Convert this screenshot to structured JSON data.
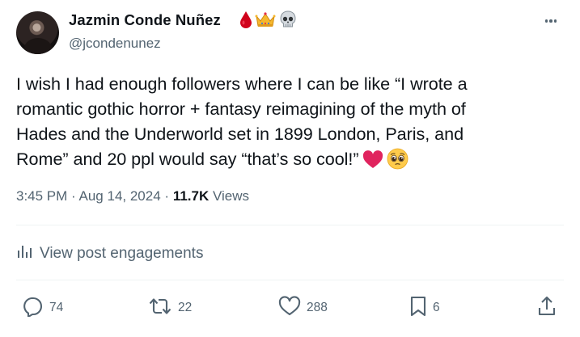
{
  "author": {
    "display_name": "Jazmin Conde Nuñez",
    "handle": "@jcondenunez",
    "name_emojis": [
      "drop-of-blood-icon",
      "crown-icon",
      "skull-icon"
    ]
  },
  "tweet": {
    "lines": [
      "I wish I had enough followers where I can be like “I wrote a",
      "romantic gothic horror + fantasy reimagining of the myth of",
      "Hades and the Underworld set in 1899 London, Paris, and",
      "Rome” and  20 ppl would say “that’s so cool!”"
    ],
    "trailing_emojis": [
      "red-heart-icon",
      "pleading-face-icon"
    ]
  },
  "meta": {
    "time": "3:45 PM",
    "separator": "·",
    "date": "Aug 14, 2024",
    "views_count": "11.7K",
    "views_label": "Views"
  },
  "engagements": {
    "label": "View post engagements"
  },
  "actions": {
    "replies": "74",
    "reposts": "22",
    "likes": "288",
    "bookmarks": "6"
  },
  "colors": {
    "text_primary": "#0f1419",
    "text_secondary": "#536471",
    "divider": "#eff3f4",
    "heart": "#e0245e",
    "blood": "#d0021b",
    "crown": "#f5b82e"
  }
}
